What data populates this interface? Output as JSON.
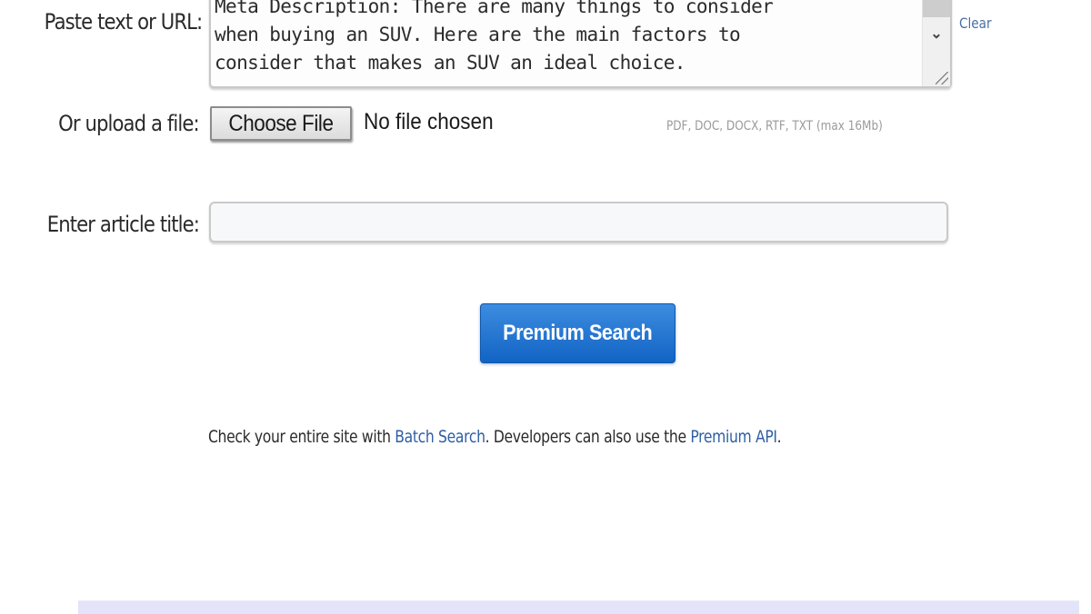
{
  "form": {
    "paste_label": "Paste text or URL:",
    "paste_value": "Meta Description: There are many things to consider\nwhen buying an SUV. Here are the main factors to\nconsider that makes an SUV an ideal choice.",
    "clear_label": "Clear",
    "upload_label": "Or upload a file:",
    "choose_file_label": "Choose File",
    "file_status": "No file chosen",
    "file_hint": "PDF, DOC, DOCX, RTF, TXT (max 16Mb)",
    "title_label": "Enter article title:",
    "title_value": "",
    "submit_label": "Premium Search"
  },
  "footer": {
    "text_1": "Check your entire site with ",
    "batch_link": "Batch Search",
    "text_2": ". Developers can also use the ",
    "api_link": "Premium API",
    "text_3": "."
  },
  "colors": {
    "primary_button": "#1b6fd0",
    "link": "#2f5fa3",
    "bottom_band": "#e3e3fa"
  }
}
